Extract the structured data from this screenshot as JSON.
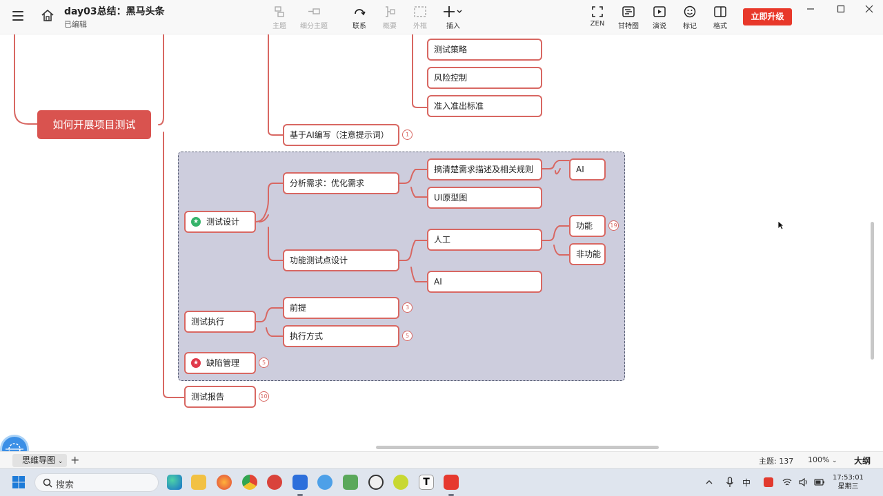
{
  "header": {
    "title": "day03总结：黑马头条",
    "status": "已编辑",
    "tools": [
      {
        "label": "主题",
        "icon": "topic-icon"
      },
      {
        "label": "细分主题",
        "icon": "subtopic-icon"
      },
      {
        "label": "联系",
        "icon": "relationship-icon"
      },
      {
        "label": "概要",
        "icon": "summary-icon"
      },
      {
        "label": "外框",
        "icon": "boundary-icon"
      },
      {
        "label": "插入",
        "icon": "insert-icon"
      },
      {
        "label": "ZEN",
        "icon": "zen-icon"
      },
      {
        "label": "甘特图",
        "icon": "gantt-icon"
      },
      {
        "label": "演说",
        "icon": "present-icon"
      },
      {
        "label": "标记",
        "icon": "marker-icon"
      },
      {
        "label": "格式",
        "icon": "format-icon"
      }
    ],
    "upgrade_label": "立即升级"
  },
  "mindmap": {
    "root": "如何开展项目测试",
    "nodes": {
      "strategy": "测试策略",
      "risk": "风险控制",
      "criteria": "准入准出标准",
      "ai_write": "基于AI编写（注意提示词）",
      "design": "测试设计",
      "analyze": "分析需求：优化需求",
      "clarify": "搞清楚需求描述及相关规则",
      "ai1": "AI",
      "ui": "UI原型图",
      "func_point": "功能测试点设计",
      "manual": "人工",
      "func": "功能",
      "nonfunc": "非功能",
      "ai2": "AI",
      "execute": "测试执行",
      "premise": "前提",
      "exec_mode": "执行方式",
      "defect": "缺陷管理",
      "report": "测试报告"
    },
    "badges": {
      "ai_write": "1",
      "func": "19",
      "premise": "3",
      "exec_mode": "5",
      "defect": "5",
      "report": "10"
    },
    "colors": {
      "node_border": "#d86762",
      "root_fill": "#d9534f",
      "group_fill": "#cdcddd"
    }
  },
  "statusbar": {
    "sheet": "思维导图",
    "add": "+",
    "topic_count": "主题: 137",
    "zoom": "100%",
    "outline": "大纲"
  },
  "taskbar": {
    "search_placeholder": "搜索",
    "time": "17:53:01",
    "weekday": "星期三",
    "ime": "中"
  }
}
